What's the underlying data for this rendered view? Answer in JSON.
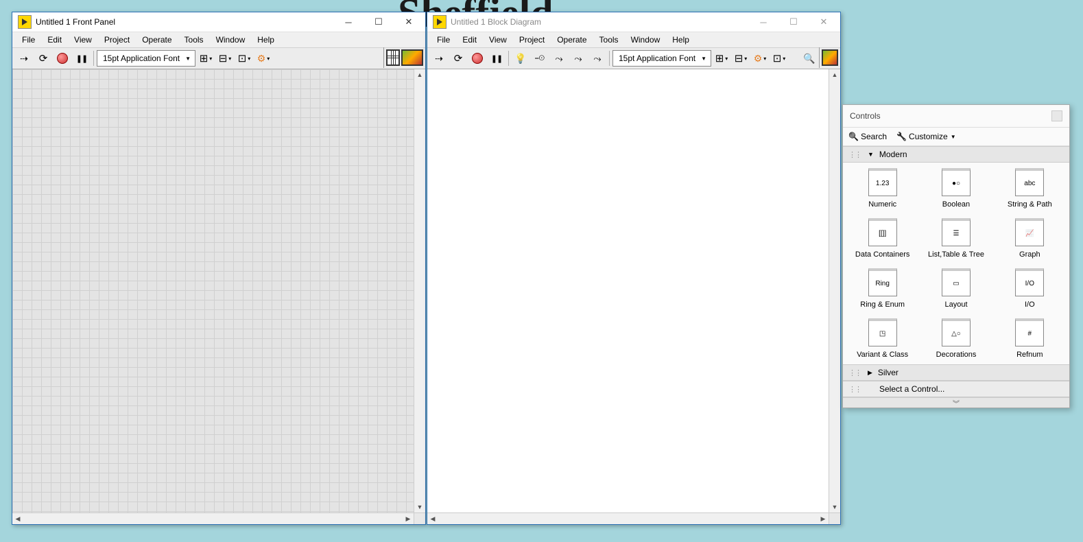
{
  "background_text": "Sheffield",
  "frontpanel": {
    "title": "Untitled 1 Front Panel",
    "menu": [
      "File",
      "Edit",
      "View",
      "Project",
      "Operate",
      "Tools",
      "Window",
      "Help"
    ],
    "font": "15pt Application Font"
  },
  "blockdiagram": {
    "title": "Untitled 1 Block Diagram",
    "menu": [
      "File",
      "Edit",
      "View",
      "Project",
      "Operate",
      "Tools",
      "Window",
      "Help"
    ],
    "font": "15pt Application Font"
  },
  "controls": {
    "title": "Controls",
    "search": "Search",
    "customize": "Customize",
    "cat_open": "Modern",
    "items": [
      "Numeric",
      "Boolean",
      "String & Path",
      "Data Containers",
      "List,Table & Tree",
      "Graph",
      "Ring & Enum",
      "Layout",
      "I/O",
      "Variant & Class",
      "Decorations",
      "Refnum"
    ],
    "cat_closed": "Silver",
    "select": "Select a Control..."
  },
  "icon_glyphs": {
    "Numeric": "1.23",
    "Boolean": "●○",
    "String & Path": "abc",
    "Data Containers": "[[]]",
    "List,Table & Tree": "☰",
    "Graph": "📈",
    "Ring & Enum": "Ring",
    "Layout": "▭",
    "I/O": "I/O",
    "Variant & Class": "◳",
    "Decorations": "△○",
    "Refnum": "#"
  }
}
